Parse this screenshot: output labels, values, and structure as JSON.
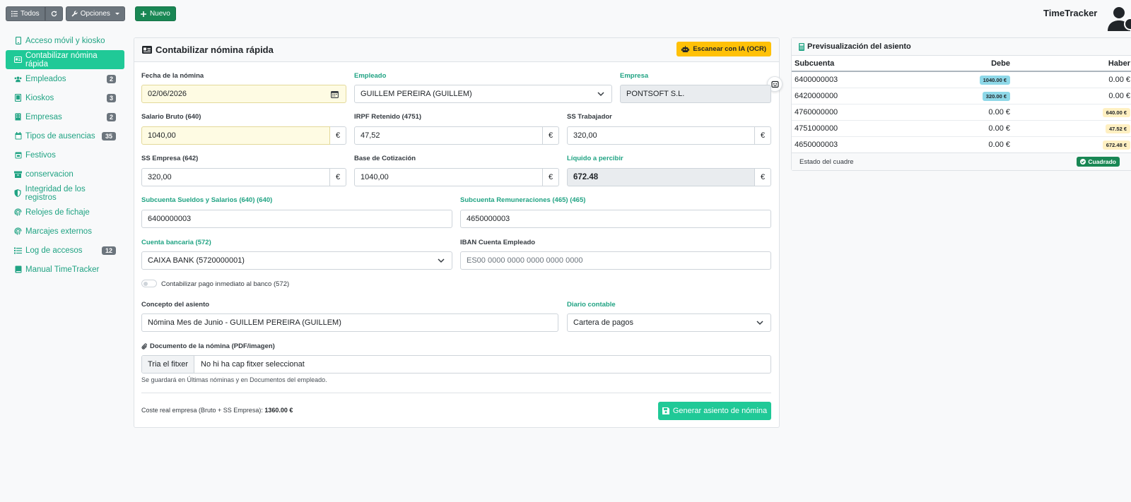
{
  "toolbar": {
    "todos_label": "Todos",
    "opciones_label": "Opciones",
    "nuevo_label": "Nuevo"
  },
  "brand": "TimeTracker",
  "sidebar": {
    "items": [
      {
        "label": "Acceso móvil y kiosko",
        "icon": "mobile-icon"
      },
      {
        "label": "Contabilizar nómina rápida",
        "icon": "id-card-icon",
        "active": true
      },
      {
        "label": "Empleados",
        "icon": "users-icon",
        "badge": "2"
      },
      {
        "label": "Kioskos",
        "icon": "tablet-icon",
        "badge": "3"
      },
      {
        "label": "Empresas",
        "icon": "building-icon",
        "badge": "2"
      },
      {
        "label": "Tipos de ausencias",
        "icon": "calendar-icon",
        "badge": "35"
      },
      {
        "label": "Festivos",
        "icon": "calendar-icon"
      },
      {
        "label": "conservacion",
        "icon": "archive-icon"
      },
      {
        "label": "Integridad de los registros",
        "icon": "shield-icon"
      },
      {
        "label": "Relojes de fichaje",
        "icon": "fingerprint-icon"
      },
      {
        "label": "Marcajes externos",
        "icon": "fingerprint-icon"
      },
      {
        "label": "Log de accesos",
        "icon": "list-icon",
        "badge": "12"
      },
      {
        "label": "Manual TimeTracker",
        "icon": "book-icon"
      }
    ]
  },
  "form": {
    "title": "Contabilizar nómina rápida",
    "ocr_label": "Escanear con IA (OCR)",
    "fecha_label": "Fecha de la nómina",
    "fecha_value": "02/06/2026",
    "empleado_label": "Empleado",
    "empleado_value": "GUILLEM PEREIRA (GUILLEM)",
    "empresa_label": "Empresa",
    "empresa_value": "PONTSOFT S.L.",
    "bruto_label": "Salario Bruto (640)",
    "bruto_value": "1040,00",
    "irpf_label": "IRPF Retenido (4751)",
    "irpf_value": "47,52",
    "sstrab_label": "SS Trabajador",
    "sstrab_value": "320,00",
    "ssemp_label": "SS Empresa (642)",
    "ssemp_value": "320,00",
    "base_label": "Base de Cotización",
    "base_value": "1040,00",
    "liquido_label": "Líquido a percibir",
    "liquido_value": "672.48",
    "currency": "€",
    "sub_sueldos_label": "Subcuenta Sueldos y Salarios (640) (640)",
    "sub_sueldos_value": "6400000003",
    "sub_remun_label": "Subcuenta Remuneraciones (465) (465)",
    "sub_remun_value": "4650000003",
    "cuenta_label": "Cuenta bancaria (572)",
    "cuenta_value": "CAIXA BANK (5720000001)",
    "iban_label": "IBAN Cuenta Empleado",
    "iban_placeholder": "ES00 0000 0000 0000 0000 0000",
    "toggle_label": "Contabilizar pago inmediato al banco (572)",
    "concepto_label": "Concepto del asiento",
    "concepto_value": "Nómina Mes de Junio - GUILLEM PEREIRA (GUILLEM)",
    "diario_label": "Diario contable",
    "diario_value": "Cartera de pagos",
    "doc_label": "Documento de la nómina (PDF/imagen)",
    "file_button": "Tria el fitxer",
    "file_text": "No hi ha cap fitxer seleccionat",
    "help_text": "Se guardará en Últimas nóminas y en Documentos del empleado.",
    "cost_label": "Coste real empresa (Bruto + SS Empresa):",
    "cost_value": "1360.00 €",
    "generate_label": "Generar asiento de nómina"
  },
  "preview": {
    "title": "Previsualización del asiento",
    "headers": {
      "subcuenta": "Subcuenta",
      "debe": "Debe",
      "haber": "Haber"
    },
    "rows": [
      {
        "subcuenta": "6400000003",
        "debe": "1040.00 €",
        "haber": "0.00 €",
        "debe_pill": true,
        "haber_pill": false
      },
      {
        "subcuenta": "6420000000",
        "debe": "320.00 €",
        "haber": "0.00 €",
        "debe_pill": true,
        "haber_pill": false
      },
      {
        "subcuenta": "4760000000",
        "debe": "0.00 €",
        "haber": "640.00 €",
        "debe_pill": false,
        "haber_pill": true
      },
      {
        "subcuenta": "4751000000",
        "debe": "0.00 €",
        "haber": "47.52 €",
        "debe_pill": false,
        "haber_pill": true
      },
      {
        "subcuenta": "4650000003",
        "debe": "0.00 €",
        "haber": "672.48 €",
        "debe_pill": false,
        "haber_pill": true
      }
    ],
    "status_label": "Estado del cuadre",
    "status_value": "Cuadrado"
  },
  "colors": {
    "teal": "#20c997",
    "green": "#198754",
    "yellow": "#ffc107"
  }
}
